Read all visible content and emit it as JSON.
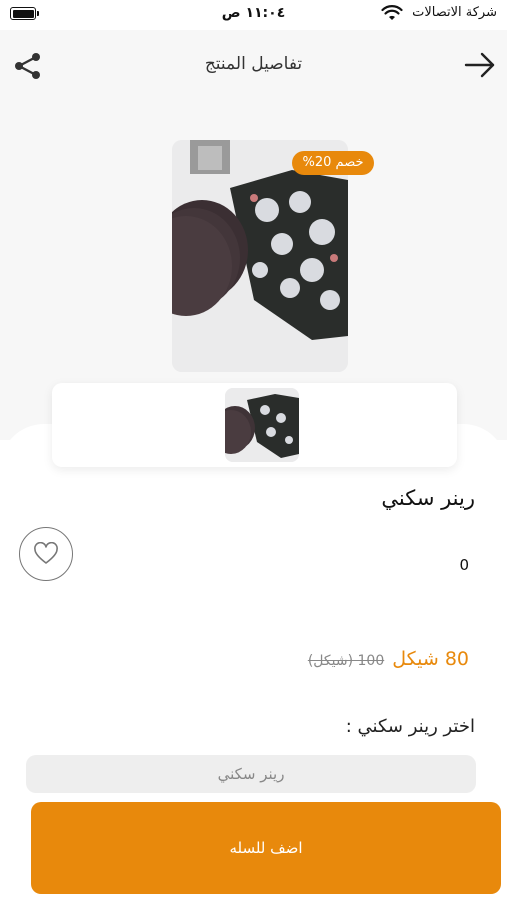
{
  "status_bar": {
    "carrier": "شركة الاتصالات",
    "time": "١١:٠٤ ص"
  },
  "header": {
    "title": "تفاصيل المنتج",
    "share_icon": "share-icon",
    "back_icon": "arrow-right-icon"
  },
  "product": {
    "discount_badge": "خصم 20%",
    "name": "رينر سكني",
    "rating_count": "0",
    "price_current": "80 شيكل",
    "price_old": "100 (شيكل)",
    "favorite_icon": "heart-icon"
  },
  "variant": {
    "label": "اختر رينر سكني :",
    "selected": "رينر سكني"
  },
  "cart": {
    "button_label": "اضف للسله"
  },
  "colors": {
    "accent": "#e8890c",
    "header_bg": "#f7f7f7",
    "select_bg": "#eeeeee"
  }
}
